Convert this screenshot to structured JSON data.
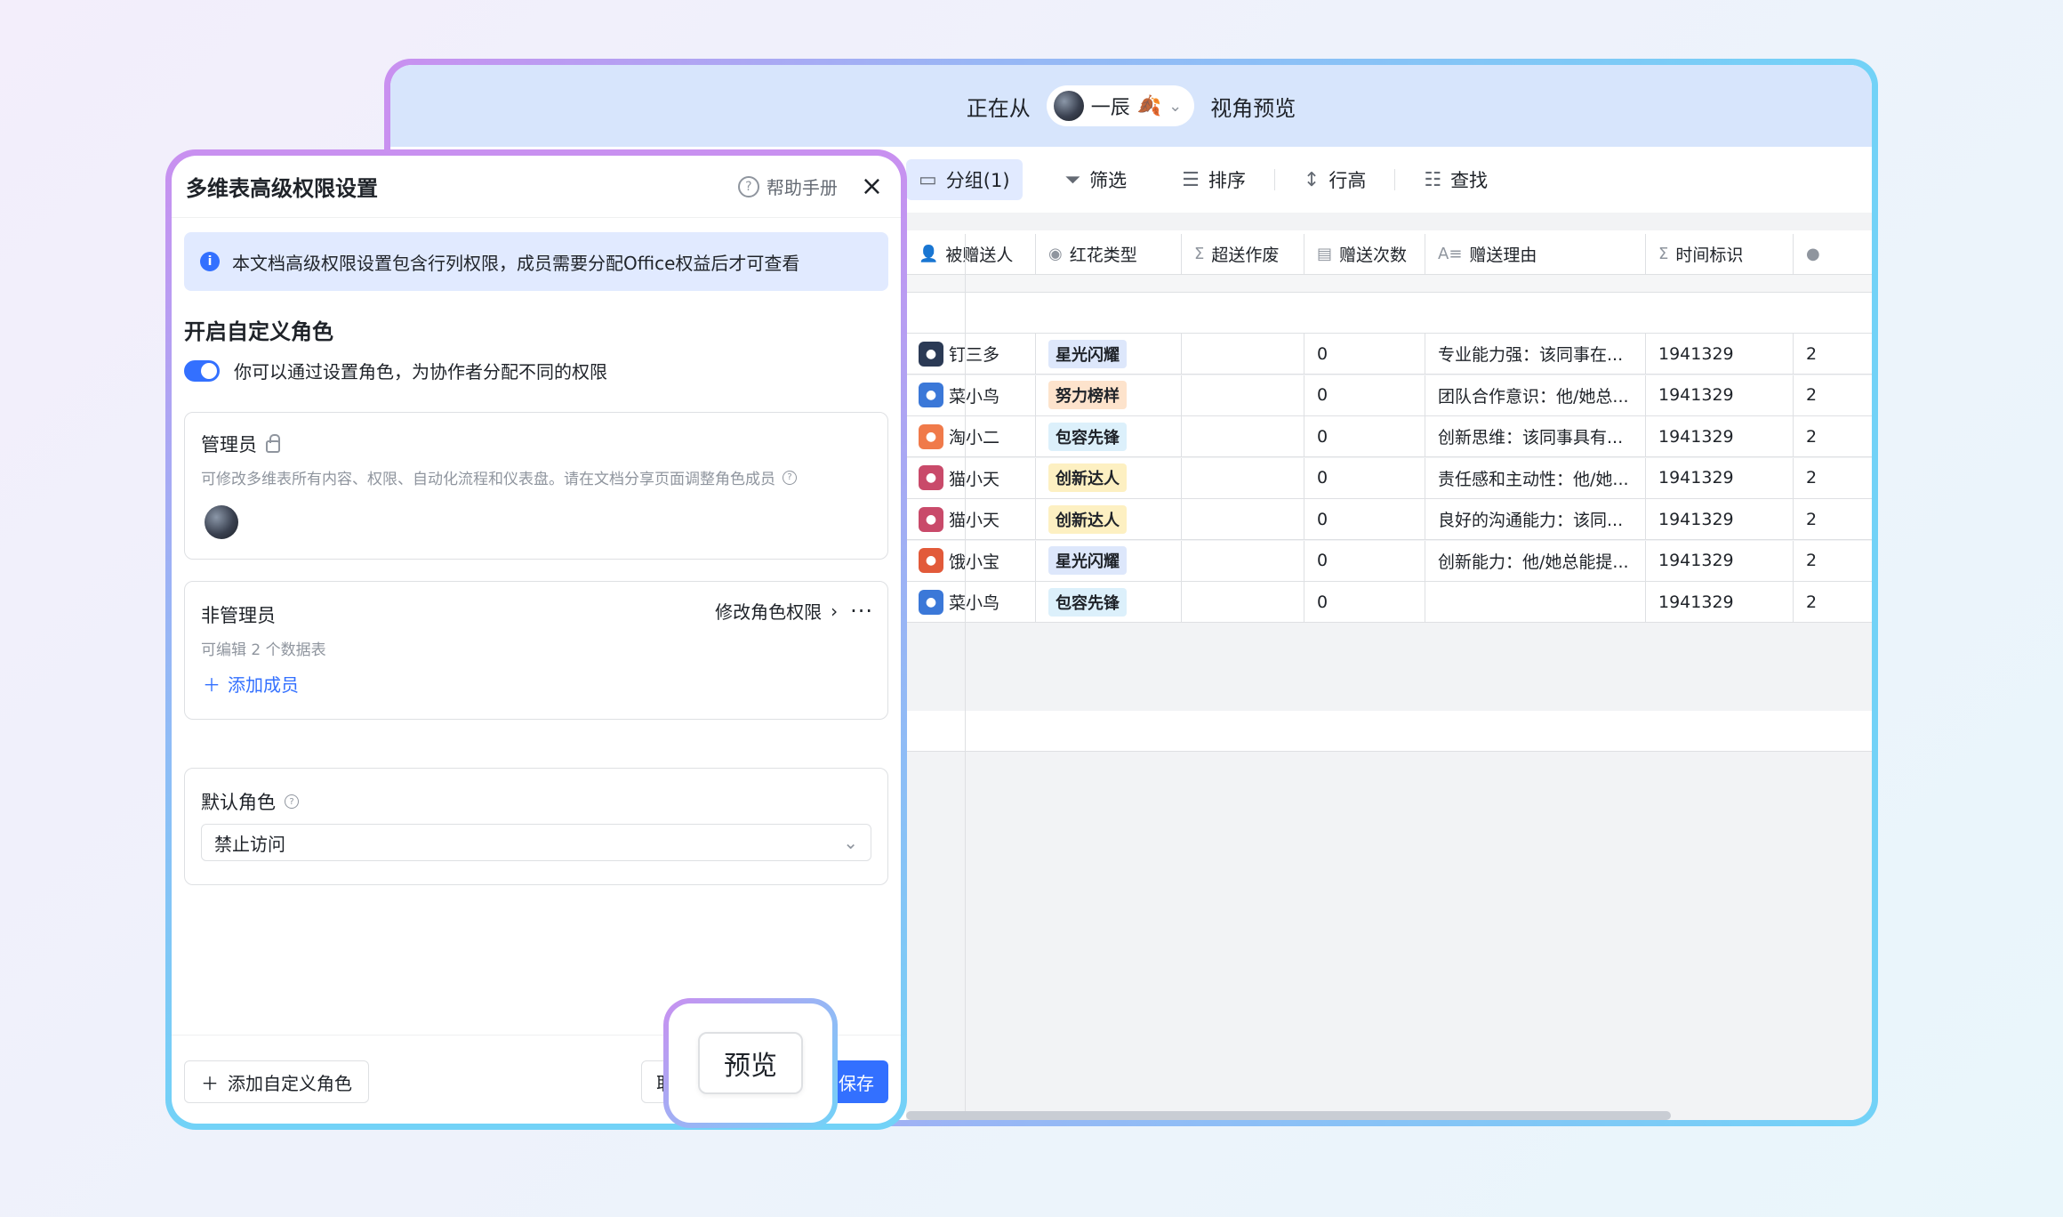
{
  "preview_bar": {
    "prefix": "正在从",
    "user_name": "一辰",
    "suffix": "视角预览"
  },
  "toolbar": {
    "group": "分组(1)",
    "filter": "筛选",
    "sort": "排序",
    "row_height": "行高",
    "find": "查找"
  },
  "table": {
    "columns": [
      "被赠送人",
      "红花类型",
      "超送作废",
      "赠送次数",
      "赠送理由",
      "时间标识"
    ],
    "rows": [
      {
        "name": "钉三多",
        "type": "星光闪耀",
        "count": "0",
        "reason": "专业能力强：该同事在...",
        "time": "1941329",
        "extra": "2"
      },
      {
        "name": "菜小鸟",
        "type": "努力榜样",
        "count": "0",
        "reason": "团队合作意识：他/她总...",
        "time": "1941329",
        "extra": "2"
      },
      {
        "name": "淘小二",
        "type": "包容先锋",
        "count": "0",
        "reason": "创新思维：该同事具有...",
        "time": "1941329",
        "extra": "2"
      },
      {
        "name": "猫小天",
        "type": "创新达人",
        "count": "0",
        "reason": "责任感和主动性：他/她...",
        "time": "1941329",
        "extra": "2"
      },
      {
        "name": "猫小天",
        "type": "创新达人",
        "count": "0",
        "reason": "良好的沟通能力：该同...",
        "time": "1941329",
        "extra": "2"
      },
      {
        "name": "饿小宝",
        "type": "星光闪耀",
        "count": "0",
        "reason": "创新能力：他/她总能提...",
        "time": "1941329",
        "extra": "2"
      },
      {
        "name": "菜小鸟",
        "type": "包容先锋",
        "count": "0",
        "reason": "",
        "time": "1941329",
        "extra": "2"
      }
    ],
    "tag_colors": {
      "星光闪耀": "#dde7fb",
      "努力榜样": "#fde3cc",
      "包容先锋": "#dcf0fb",
      "创新达人": "#fdf0c2"
    },
    "avatar_colors": [
      "#2b3a55",
      "#3b78d8",
      "#f07a4a",
      "#c94a6a",
      "#c94a6a",
      "#e25a3a",
      "#3b78d8"
    ]
  },
  "panel": {
    "title": "多维表高级权限设置",
    "help": "帮助手册",
    "info": "本文档高级权限设置包含行列权限，成员需要分配Office权益后才可查看",
    "section_title": "开启自定义角色",
    "toggle_label": "你可以通过设置角色，为协作者分配不同的权限",
    "admin": {
      "title": "管理员",
      "desc": "可修改多维表所有内容、权限、自动化流程和仪表盘。请在文档分享页面调整角色成员"
    },
    "non_admin": {
      "title": "非管理员",
      "desc": "可编辑 2 个数据表",
      "edit_link": "修改角色权限",
      "add_member": "添加成员"
    },
    "default_role": {
      "title": "默认角色",
      "value": "禁止访问"
    },
    "footer": {
      "add_role": "添加自定义角色",
      "cancel": "取",
      "save": "保存"
    }
  },
  "callout": {
    "preview": "预览"
  }
}
